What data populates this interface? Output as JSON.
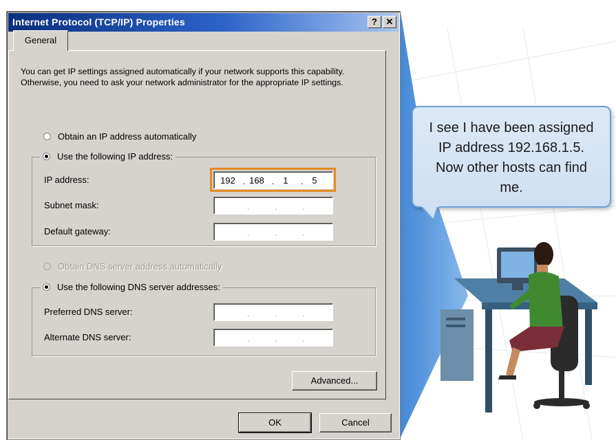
{
  "window": {
    "title": "Internet Protocol (TCP/IP) Properties",
    "help_label": "?",
    "close_label": "✕"
  },
  "tabs": [
    {
      "label": "General"
    }
  ],
  "description": "You can get IP settings assigned automatically if your network supports this capability. Otherwise, you need to ask your network administrator for the appropriate IP settings.",
  "ip_section": {
    "auto_label": "Obtain an IP address automatically",
    "manual_label": "Use the following IP address:",
    "selected": "manual",
    "fields": [
      {
        "label": "IP address:",
        "octets": [
          "192",
          "168",
          "1",
          "5"
        ]
      },
      {
        "label": "Subnet mask:",
        "octets": [
          "",
          "",
          "",
          ""
        ]
      },
      {
        "label": "Default gateway:",
        "octets": [
          "",
          "",
          "",
          ""
        ]
      }
    ]
  },
  "dns_section": {
    "auto_label": "Obtain DNS server address automatically",
    "manual_label": "Use the following DNS server addresses:",
    "selected": "manual",
    "fields": [
      {
        "label": "Preferred DNS server:",
        "octets": [
          "",
          "",
          "",
          ""
        ]
      },
      {
        "label": "Alternate DNS server:",
        "octets": [
          "",
          "",
          "",
          ""
        ]
      }
    ]
  },
  "buttons": {
    "advanced": "Advanced...",
    "ok": "OK",
    "cancel": "Cancel"
  },
  "bubble": {
    "text": "I see I have been assigned\nIP address 192.168.1.5.\nNow other hosts can find\nme."
  },
  "colors": {
    "title_start": "#0a2e7c",
    "title_end": "#a7c5f1",
    "dialog_bg": "#d6d3ce",
    "highlight": "#e58a1f",
    "beam": "#3d86d6",
    "bubble_bg": "#d6e6f6"
  }
}
